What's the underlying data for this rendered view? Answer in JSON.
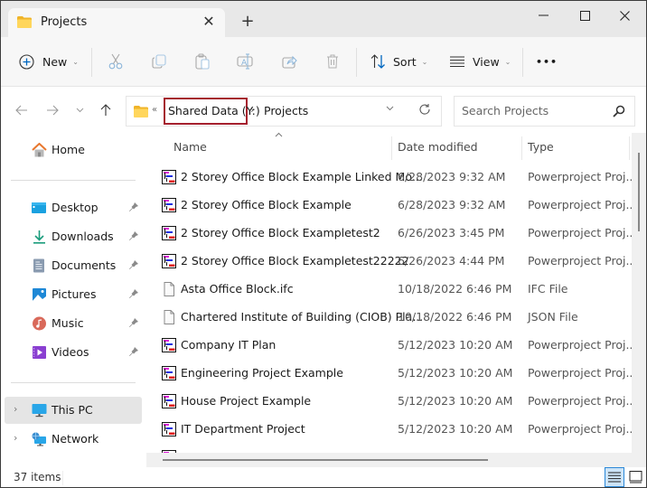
{
  "window": {
    "tab_title": "Projects",
    "new_tab_label": "+",
    "controls": {
      "minimize": "minimize-icon",
      "maximize": "maximize-icon",
      "close": "close-icon"
    }
  },
  "toolbar": {
    "new_label": "New",
    "sort_label": "Sort",
    "view_label": "View",
    "more_label": "•••",
    "icons": [
      "new-icon",
      "cut-icon",
      "copy-icon",
      "paste-icon",
      "rename-icon",
      "share-icon",
      "delete-icon",
      "sort-icon",
      "view-icon",
      "more-icon"
    ]
  },
  "address": {
    "overflow": "«",
    "breadcrumbs": [
      "Shared Data (Y:)",
      "Projects"
    ],
    "separator": "›",
    "search_placeholder": "Search Projects"
  },
  "sidebar": {
    "home": {
      "label": "Home",
      "icon": "home-icon"
    },
    "quick_access": [
      {
        "label": "Desktop",
        "icon": "desktop-icon",
        "pinned": true
      },
      {
        "label": "Downloads",
        "icon": "downloads-icon",
        "pinned": true
      },
      {
        "label": "Documents",
        "icon": "documents-icon",
        "pinned": true
      },
      {
        "label": "Pictures",
        "icon": "pictures-icon",
        "pinned": true
      },
      {
        "label": "Music",
        "icon": "music-icon",
        "pinned": true
      },
      {
        "label": "Videos",
        "icon": "videos-icon",
        "pinned": true
      }
    ],
    "locations": [
      {
        "label": "This PC",
        "icon": "this-pc-icon",
        "selected": true
      },
      {
        "label": "Network",
        "icon": "network-icon",
        "selected": false
      }
    ]
  },
  "filelist": {
    "columns": {
      "name": "Name",
      "date": "Date modified",
      "type": "Type"
    },
    "sort_indicator": "^",
    "rows": [
      {
        "name": "2 Storey Office Block Example Linked Mo...",
        "date": "6/28/2023 9:32 AM",
        "type": "Powerproject Proj...",
        "icon": "powerproject-icon"
      },
      {
        "name": "2 Storey Office Block Example",
        "date": "6/28/2023 9:32 AM",
        "type": "Powerproject Proj...",
        "icon": "powerproject-icon"
      },
      {
        "name": "2 Storey Office Block Exampletest2",
        "date": "6/26/2023 3:45 PM",
        "type": "Powerproject Proj...",
        "icon": "powerproject-icon"
      },
      {
        "name": "2 Storey Office Block Exampletest22222",
        "date": "6/26/2023 4:44 PM",
        "type": "Powerproject Proj...",
        "icon": "powerproject-icon"
      },
      {
        "name": "Asta Office Block.ifc",
        "date": "10/18/2022 6:46 PM",
        "type": "IFC File",
        "icon": "generic-file-icon"
      },
      {
        "name": "Chartered Institute of Building (CIOB) Pla...",
        "date": "10/18/2022 6:46 PM",
        "type": "JSON File",
        "icon": "generic-file-icon"
      },
      {
        "name": "Company IT Plan",
        "date": "5/12/2023 10:20 AM",
        "type": "Powerproject Proj...",
        "icon": "powerproject-icon"
      },
      {
        "name": "Engineering Project Example",
        "date": "5/12/2023 10:20 AM",
        "type": "Powerproject Proj...",
        "icon": "powerproject-icon"
      },
      {
        "name": "House Project Example",
        "date": "5/12/2023 10:20 AM",
        "type": "Powerproject Proj...",
        "icon": "powerproject-icon"
      },
      {
        "name": "IT Department Project",
        "date": "5/12/2023 10:20 AM",
        "type": "Powerproject Proj...",
        "icon": "powerproject-icon"
      }
    ]
  },
  "status": {
    "item_count": "37 items"
  },
  "colors": {
    "highlight_border": "#a5202e",
    "accent": "#0067c0",
    "selected_bg": "#e5e5e5"
  }
}
